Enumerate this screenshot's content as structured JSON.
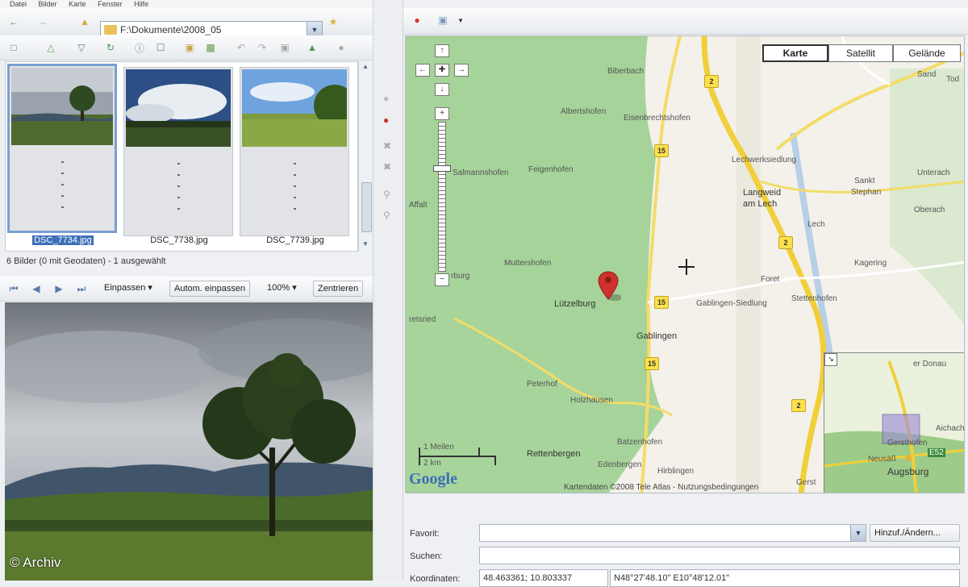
{
  "menu": [
    "Datei",
    "Bilder",
    "Karte",
    "Fenster",
    "Hilfe"
  ],
  "toolbar": {
    "path": "F:\\Dokumente\\2008_05"
  },
  "thumbnails": [
    {
      "filename": "DSC_7734.jpg",
      "selected": true
    },
    {
      "filename": "DSC_7738.jpg",
      "selected": false
    },
    {
      "filename": "DSC_7739.jpg",
      "selected": false
    }
  ],
  "status": "6 Bilder (0 mit Geodaten) - 1 ausgewählt",
  "preview_toolbar": {
    "fit": "Einpassen",
    "auto_fit": "Autom. einpassen",
    "zoom": "100%",
    "center": "Zentrieren"
  },
  "map": {
    "types": [
      "Karte",
      "Satellit",
      "Gelände"
    ],
    "active_type": "Karte",
    "places": {
      "billerbach": "Biberbach",
      "albertshofen": "Albertshofen",
      "eisenbrechtshofen": "Eisenbrechtshofen",
      "salmannshofen": "Salmannshofen",
      "feigenhofen": "Feigenhofen",
      "affaltern": "Affalt",
      "muttershofen": "Muttershofen",
      "lutzelburg": "Lützelburg",
      "gablingen": "Gablingen",
      "gablingen_siedlung": "Gablingen-Siedlung",
      "foret": "Foret",
      "stettenhofen": "Stettenhofen",
      "langweid": "Langweid",
      "am_lech": "am Lech",
      "lechwerksiedlung": "Lechwerksiedlung",
      "sankt_stephan": "Sankt",
      "stephan": "Stephan",
      "unterach": "Unterach",
      "oberach": "Oberach",
      "kagering": "Kagering",
      "lech": "Lech",
      "peterhof": "Peterhof",
      "holzhausen": "Holzhausen",
      "rettenbergen": "Rettenbergen",
      "batzenhofen": "Batzenhofen",
      "edenbergen": "Edenbergen",
      "hirblingen": "Hirblingen",
      "sand": "Sand",
      "retsried": "retsried",
      "burg": "rburg",
      "gersthofen": "Gerst",
      "todt": "Tod"
    },
    "scale_top": "1 Meilen",
    "scale_bottom": "2 km",
    "copyright": "Kartendaten ©2008 Tele Atlas - Nutzungsbedingungen",
    "google": "Google",
    "overview": {
      "augsburg": "Augsburg",
      "donau": "er Donau",
      "achach": "Aichach",
      "e52": "E52",
      "gersthofen": "Gersthofen",
      "neusass": "Neusäß"
    }
  },
  "form": {
    "favorit_label": "Favorit:",
    "favorit_value": "",
    "add_button": "Hinzuf./Ändern...",
    "search_label": "Suchen:",
    "search_value": "",
    "coords_label": "Koordinaten:",
    "coords_decimal": "48.463361; 10.803337",
    "coords_dms": "N48°27'48.10\" E10°48'12.01\""
  },
  "credit": "© Archiv"
}
